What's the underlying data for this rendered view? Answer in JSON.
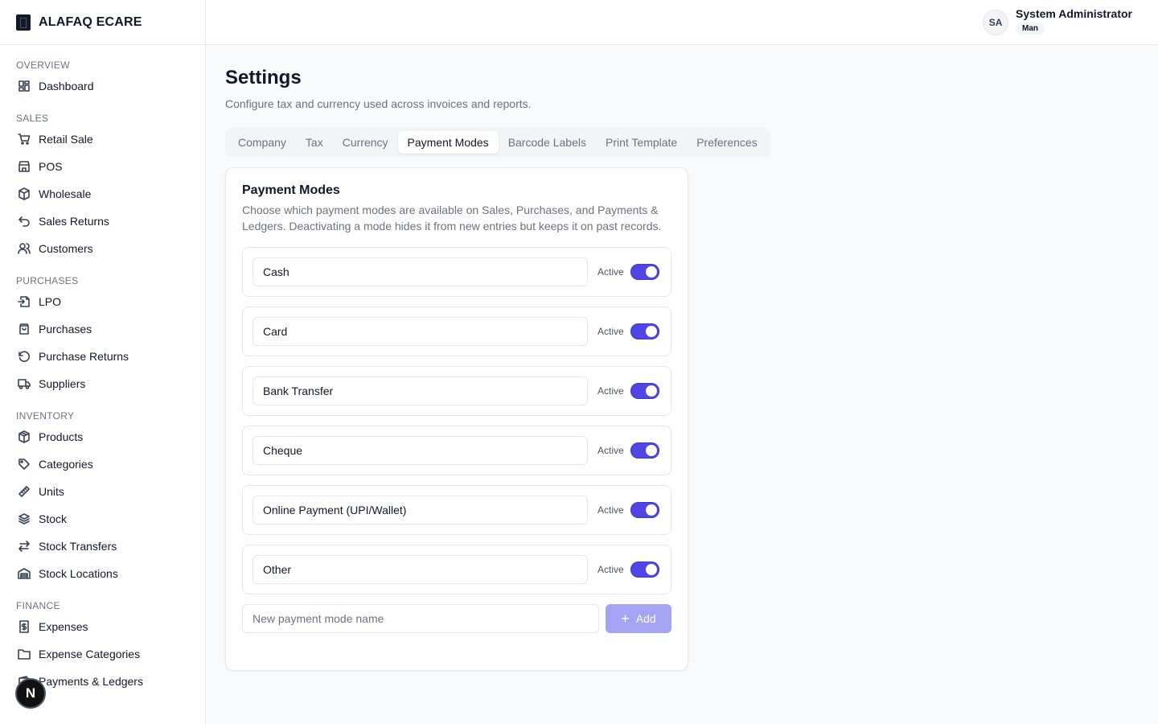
{
  "brand": {
    "name": "ALAFAQ ECARE"
  },
  "header": {
    "user_initials": "SA",
    "user_name": "System Administrator",
    "user_role": "Man"
  },
  "sidebar": {
    "overview_label": "OVERVIEW",
    "dashboard": "Dashboard",
    "sales_label": "SALES",
    "retail_sale": "Retail Sale",
    "pos": "POS",
    "wholesale": "Wholesale",
    "sales_returns": "Sales Returns",
    "customers": "Customers",
    "purchases_label": "PURCHASES",
    "lpo": "LPO",
    "purchases": "Purchases",
    "purchase_returns": "Purchase Returns",
    "suppliers": "Suppliers",
    "inventory_label": "INVENTORY",
    "products": "Products",
    "categories": "Categories",
    "units": "Units",
    "stock": "Stock",
    "stock_transfers": "Stock Transfers",
    "stock_locations": "Stock Locations",
    "finance_label": "FINANCE",
    "expenses": "Expenses",
    "expense_categories": "Expense Categories",
    "payments_ledgers": "Payments & Ledgers"
  },
  "page": {
    "title": "Settings",
    "subtitle": "Configure tax and currency used across invoices and reports."
  },
  "tabs": {
    "company": "Company",
    "tax": "Tax",
    "currency": "Currency",
    "payment_modes": "Payment Modes",
    "barcode_labels": "Barcode Labels",
    "print_template": "Print Template",
    "preferences": "Preferences"
  },
  "card": {
    "title": "Payment Modes",
    "description": "Choose which payment modes are available on Sales, Purchases, and Payments & Ledgers. Deactivating a mode hides it from new entries but keeps it on past records.",
    "active_label": "Active",
    "modes": {
      "cash": "Cash",
      "card": "Card",
      "bank_transfer": "Bank Transfer",
      "cheque": "Cheque",
      "online": "Online Payment (UPI/Wallet)",
      "other": "Other"
    },
    "new_placeholder": "New payment mode name",
    "add_label": "Add"
  },
  "badge": {
    "letter": "N"
  },
  "colors": {
    "accent": "#4f46e5",
    "add_button": "#a5a3f3"
  }
}
